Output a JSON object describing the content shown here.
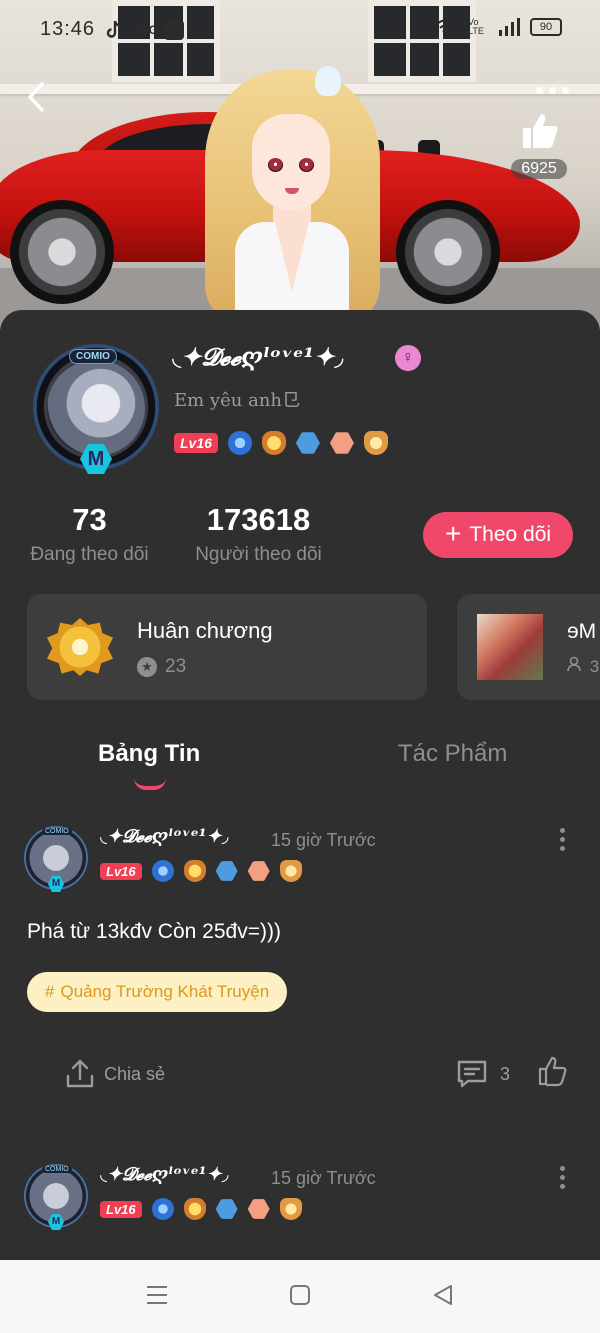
{
  "status_bar": {
    "time": "13:46",
    "app_label": "VNG",
    "battery": "90",
    "network": "Vo LTE"
  },
  "hero": {
    "like_count": "6925",
    "back_icon": "chevron-left-icon",
    "more_icon": "more-dots-icon",
    "like_icon": "thumbs-up-icon"
  },
  "profile": {
    "avatar_brand": "COMIO",
    "avatar_mark": "M",
    "username": "◟✦𝓓𝓮𝓮ღˡᵒᵛᵉ¹✦◞",
    "gender_icon": "female-icon",
    "bio": "Em yêu anh⺋",
    "level": "Lv16"
  },
  "stats": {
    "following_count": "73",
    "following_label": "Đang theo dõi",
    "followers_count": "173618",
    "followers_label": "Người theo dõi",
    "follow_button": "Theo dõi"
  },
  "medal_card": {
    "title": "Huân chương",
    "count": "23"
  },
  "group_card": {
    "name": "ɘM",
    "sub": "3"
  },
  "tabs": {
    "feed": "Bảng Tin",
    "works": "Tác Phẩm"
  },
  "posts": [
    {
      "author": "◟✦𝓓𝓮𝓮ღˡᵒᵛᵉ¹✦◞",
      "time": "15 giờ Trước",
      "level": "Lv16",
      "text": "Phá từ 13kđv Còn 25đv=)))",
      "hashtag": "Quảng Trường Khát Truyện",
      "share_label": "Chia sẻ",
      "comment_count": "3"
    },
    {
      "author": "◟✦𝓓𝓮𝓮ღˡᵒᵛᵉ¹✦◞",
      "time": "15 giờ Trước",
      "level": "Lv16"
    }
  ],
  "accent_colors": {
    "primary": "#f0486a",
    "level_badge": "#f03e52",
    "hashtag_bg": "#fdf0c4"
  }
}
